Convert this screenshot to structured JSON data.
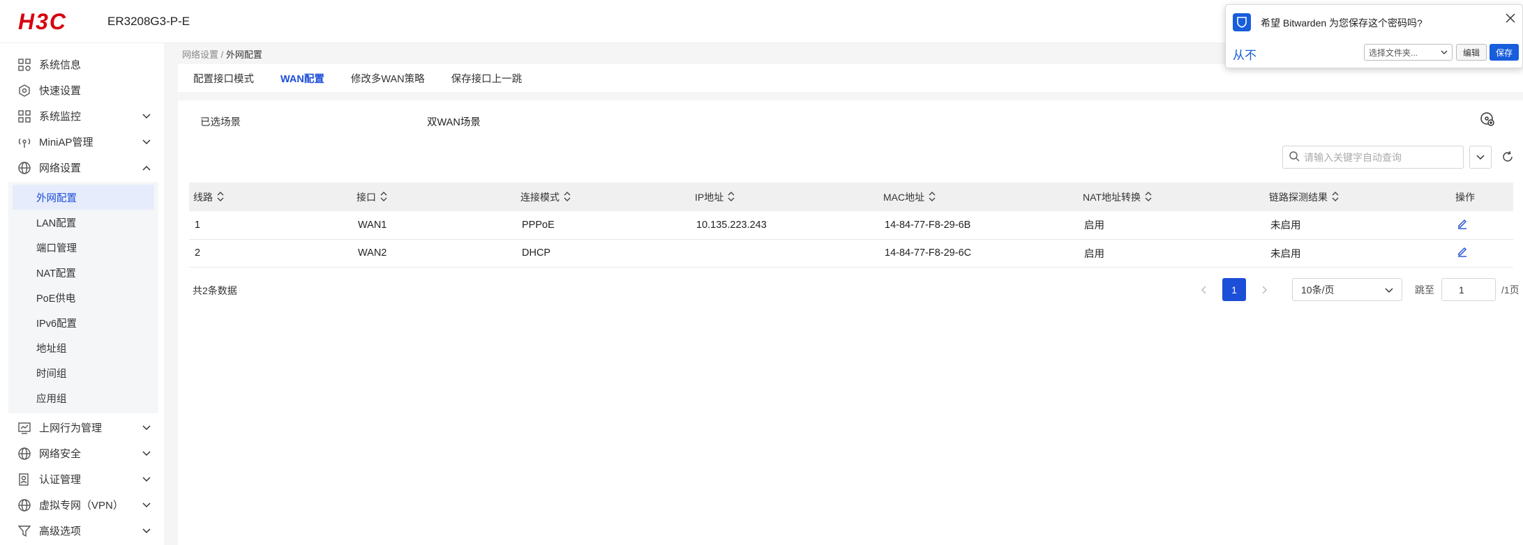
{
  "header": {
    "logo_text": "H3C",
    "device_name": "ER3208G3-P-E"
  },
  "sidebar": {
    "items": [
      {
        "label": "系统信息",
        "icon": "system-info-icon"
      },
      {
        "label": "快速设置",
        "icon": "quick-setup-icon"
      },
      {
        "label": "系统监控",
        "icon": "monitor-icon"
      },
      {
        "label": "MiniAP管理",
        "icon": "miniap-icon"
      },
      {
        "label": "网络设置",
        "icon": "network-icon"
      }
    ],
    "submenu": [
      "外网配置",
      "LAN配置",
      "端口管理",
      "NAT配置",
      "PoE供电",
      "IPv6配置",
      "地址组",
      "时间组",
      "应用组"
    ],
    "items_after": [
      {
        "label": "上网行为管理",
        "icon": "behavior-icon"
      },
      {
        "label": "网络安全",
        "icon": "security-icon"
      },
      {
        "label": "认证管理",
        "icon": "auth-icon"
      },
      {
        "label": "虚拟专网（VPN）",
        "icon": "vpn-icon"
      },
      {
        "label": "高级选项",
        "icon": "advanced-icon"
      }
    ]
  },
  "breadcrumb": {
    "parent": "网络设置",
    "sep": " / ",
    "current": "外网配置"
  },
  "tabs": [
    "配置接口模式",
    "WAN配置",
    "修改多WAN策略",
    "保存接口上一跳"
  ],
  "scene": {
    "label": "已选场景",
    "value": "双WAN场景"
  },
  "search": {
    "placeholder": "请输入关键字自动查询"
  },
  "table": {
    "headers": [
      "线路",
      "接口",
      "连接模式",
      "IP地址",
      "MAC地址",
      "NAT地址转换",
      "链路探测结果",
      "操作"
    ],
    "rows": [
      [
        "1",
        "WAN1",
        "PPPoE",
        "10.135.223.243",
        "14-84-77-F8-29-6B",
        "启用",
        "未启用"
      ],
      [
        "2",
        "WAN2",
        "DHCP",
        "",
        "14-84-77-F8-29-6C",
        "启用",
        "未启用"
      ]
    ]
  },
  "pagination": {
    "total": "共2条数据",
    "page": "1",
    "page_size": "10条/页",
    "goto": "跳至",
    "goto_value": "1",
    "total_pages": "/1页"
  },
  "bitwarden": {
    "message": "希望 Bitwarden 为您保存这个密码吗?",
    "never": "从不",
    "folder": "选择文件夹...",
    "edit": "编辑",
    "save": "保存"
  },
  "colors": {
    "accent": "#1d4ed8",
    "brand_red": "#d7000f",
    "bitwarden_blue": "#175ddc"
  }
}
